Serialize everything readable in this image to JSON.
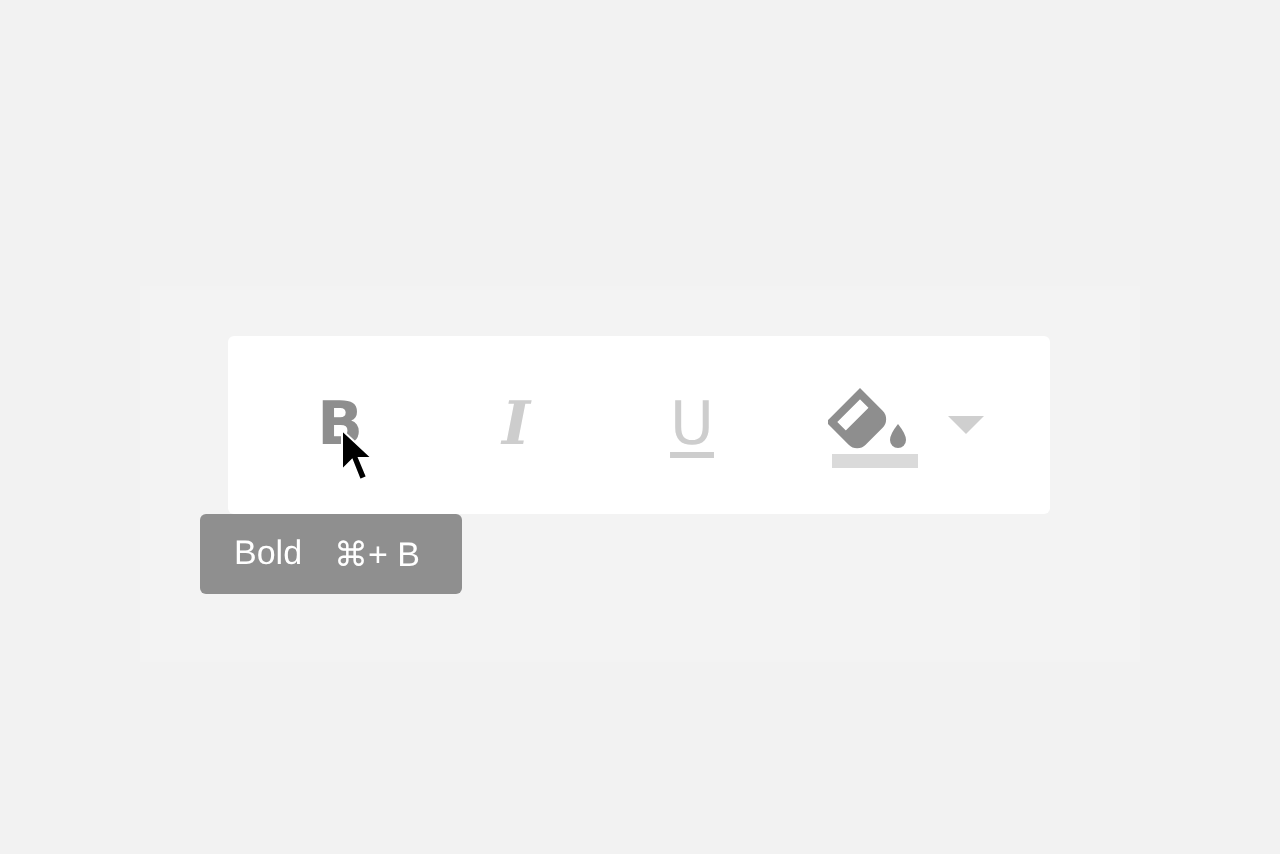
{
  "toolbar": {
    "buttons": [
      {
        "kind": "bold",
        "label": "B",
        "hovered": true
      },
      {
        "kind": "italic",
        "label": "I",
        "hovered": false
      },
      {
        "kind": "underline",
        "label": "U",
        "hovered": false
      },
      {
        "kind": "fill"
      }
    ]
  },
  "tooltip": {
    "label": "Bold",
    "shortcut": "⌘+ B"
  }
}
